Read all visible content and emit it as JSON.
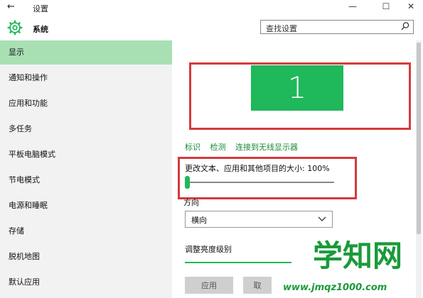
{
  "window": {
    "title": "设置",
    "back_glyph": "←",
    "minimize_glyph": "—",
    "maximize_glyph": "☐",
    "close_glyph": "✕"
  },
  "header": {
    "app_name": "系统",
    "search_placeholder": "查找设置"
  },
  "sidebar": {
    "items": [
      {
        "label": "显示",
        "selected": true
      },
      {
        "label": "通知和操作"
      },
      {
        "label": "应用和功能"
      },
      {
        "label": "多任务"
      },
      {
        "label": "平板电脑模式"
      },
      {
        "label": "节电模式"
      },
      {
        "label": "电源和睡眠"
      },
      {
        "label": "存储"
      },
      {
        "label": "脱机地图"
      },
      {
        "label": "默认应用"
      }
    ]
  },
  "display": {
    "monitor_number": "1",
    "links": [
      "标识",
      "检测",
      "连接到无线显示器"
    ],
    "scale_label": "更改文本、应用和其他项目的大小: 100%",
    "orientation_label": "方向",
    "orientation_value": "横向",
    "brightness_label": "调整亮度级别",
    "apply_button": "应用",
    "cancel_button": "取"
  },
  "watermark": {
    "text": "学知网",
    "url": "www.jmqz1000.com"
  },
  "colors": {
    "accent": "#1fb85a",
    "highlight_border": "#d63a3a",
    "selected_nav": "#a8e0b4",
    "link": "#1a8a3a"
  }
}
